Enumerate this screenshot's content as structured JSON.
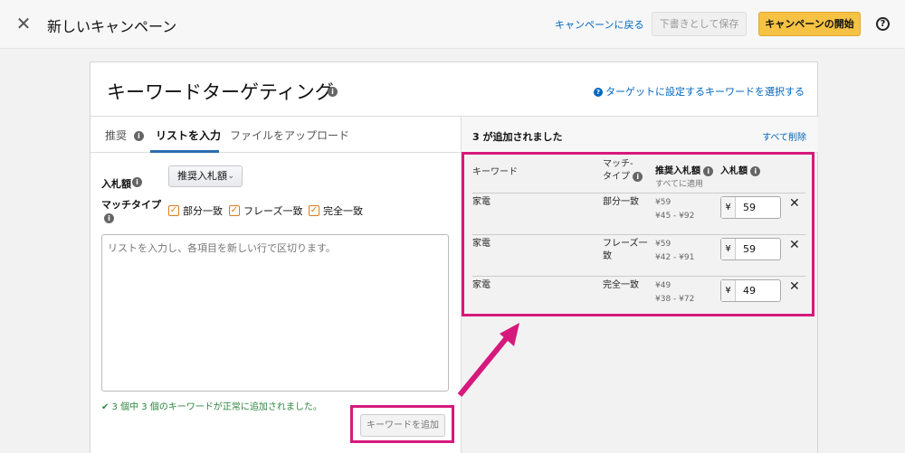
{
  "topbar": {
    "title": "新しいキャンペーン",
    "back_label": "キャンペーンに戻る",
    "draft_label": "下書きとして保存",
    "start_label": "キャンペーンの開始",
    "help_glyph": "?"
  },
  "card": {
    "title": "キーワードターゲティング",
    "select_link": "ターゲットに設定するキーワードを選択する"
  },
  "tabs": [
    {
      "label": "推奨",
      "active": false
    },
    {
      "label": "リストを入力",
      "active": true
    },
    {
      "label": "ファイルをアップロード",
      "active": false
    }
  ],
  "form": {
    "bid_label": "入札額",
    "bid_select": "推奨入札額",
    "match_label_line1": "マッチタイプ",
    "checkboxes": [
      {
        "label": "部分一致",
        "checked": true
      },
      {
        "label": "フレーズ一致",
        "checked": true
      },
      {
        "label": "完全一致",
        "checked": true
      }
    ],
    "textarea_placeholder": "リストを入力し、各項目を新しい行で区切ります。",
    "success_msg": "✔ 3 個中 3 個のキーワードが正常に追加されました。",
    "add_button": "キーワードを追加"
  },
  "right": {
    "added_count": "3 が追加されました",
    "delete_all": "すべて削除",
    "headers": {
      "keyword": "キーワード",
      "match_line1": "マッチ-",
      "match_line2": "タイプ",
      "suggested": "推奨入札額",
      "apply_all": "すべてに適用",
      "bid": "入札額"
    },
    "rows": [
      {
        "keyword": "家電",
        "match": "部分一致",
        "match2": "",
        "suggested": "¥59",
        "range": "¥45 - ¥92",
        "currency": "¥",
        "bid": "59"
      },
      {
        "keyword": "家電",
        "match": "フレーズ一",
        "match2": "致",
        "suggested": "¥59",
        "range": "¥42 - ¥91",
        "currency": "¥",
        "bid": "59"
      },
      {
        "keyword": "家電",
        "match": "完全一致",
        "match2": "",
        "suggested": "¥49",
        "range": "¥38 - ¥72",
        "currency": "¥",
        "bid": "49"
      }
    ]
  },
  "colors": {
    "highlight": "#d6197c",
    "link": "#0066c0",
    "primary_button": "#f5c244",
    "success": "#2e8540"
  },
  "icons": [
    "close-icon",
    "info-icon",
    "help-icon",
    "question-icon",
    "chevron-down-icon",
    "checkmark-icon",
    "remove-icon",
    "arrow-icon"
  ]
}
